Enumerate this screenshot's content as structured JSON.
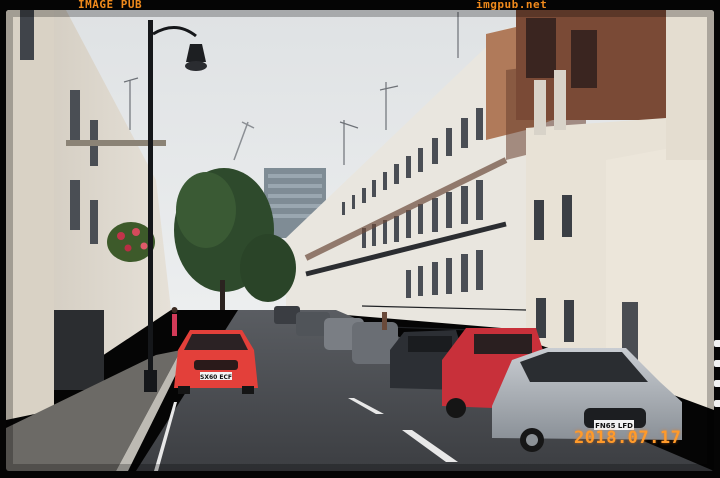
{
  "frame": {
    "brand_left": "IMAGE PUB",
    "brand_right": "imgpub.net"
  },
  "photo": {
    "date_stamp": "2018.07.17",
    "number_plates": {
      "red_hatchback": "SX60 ECF",
      "silver_coupe": "FN65 LFD"
    }
  },
  "colors": {
    "frame": "#050505",
    "film_label": "#f08a1c",
    "date_stamp": "#ff9a2a",
    "red_car": "#e3403a",
    "sky": "#e6e8ea"
  }
}
